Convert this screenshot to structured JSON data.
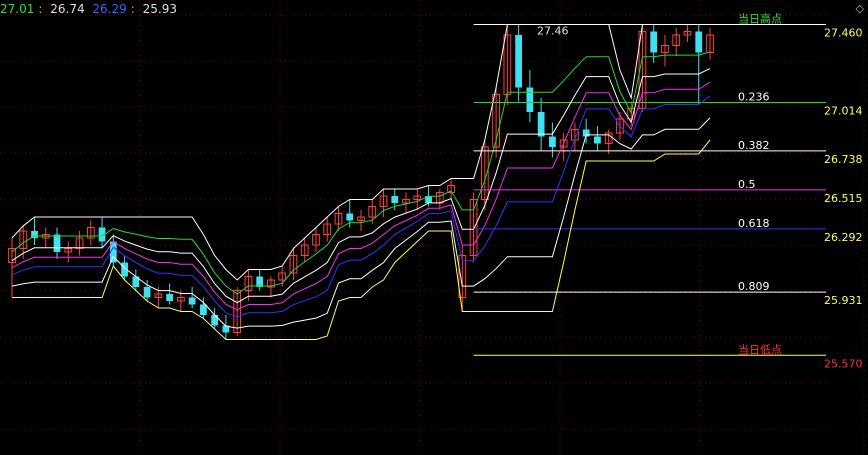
{
  "legend": {
    "v1": "27.01",
    "v1_color": "#33dd33",
    "v2": "26.74",
    "v2_color": "#e0e0e0",
    "v3": "26.29",
    "v3_color": "#3366ff",
    "v4": "25.93",
    "v4_color": "#e0e0e0"
  },
  "corner_glyph": "◇",
  "colors": {
    "up": "#ff4040",
    "down": "#40e0f0",
    "grid": "#7a0000",
    "price_label": "#ffff55",
    "low_label": "#ff3030"
  },
  "chart_data": {
    "type": "candlestick",
    "ylim": [
      25.0,
      27.6
    ],
    "grid": true,
    "high_marker": "27.46",
    "fib_levels": [
      {
        "ratio": "当日高点",
        "value": 27.46,
        "value_text": "27.460",
        "color": "#ffffff",
        "text_color": "#33dd33"
      },
      {
        "ratio": "0.236",
        "value": 27.014,
        "value_text": "27.014",
        "color": "#22dd22",
        "text_color": "#ffffff"
      },
      {
        "ratio": "0.382",
        "value": 26.738,
        "value_text": "26.738",
        "color": "#ffffff",
        "text_color": "#ffffff"
      },
      {
        "ratio": "0.5",
        "value": 26.515,
        "value_text": "26.515",
        "color": "#ee33ee",
        "text_color": "#ffffff"
      },
      {
        "ratio": "0.618",
        "value": 26.292,
        "value_text": "26.292",
        "color": "#3333ff",
        "text_color": "#ffffff"
      },
      {
        "ratio": "0.809",
        "value": 25.931,
        "value_text": "25.931",
        "color": "#ffffff",
        "text_color": "#ffffff"
      },
      {
        "ratio": "当日低点",
        "value": 25.57,
        "value_text": "25.570",
        "color": "#ffff55",
        "text_color": "#ff3030"
      }
    ],
    "candles": [
      [
        26.1,
        26.24,
        25.9,
        26.18
      ],
      [
        26.18,
        26.31,
        26.12,
        26.28
      ],
      [
        26.28,
        26.36,
        26.2,
        26.24
      ],
      [
        26.24,
        26.3,
        26.18,
        26.26
      ],
      [
        26.26,
        26.3,
        26.12,
        26.16
      ],
      [
        26.16,
        26.22,
        26.1,
        26.18
      ],
      [
        26.18,
        26.28,
        26.14,
        26.24
      ],
      [
        26.24,
        26.34,
        26.2,
        26.3
      ],
      [
        26.3,
        26.36,
        26.18,
        26.22
      ],
      [
        26.22,
        26.26,
        26.08,
        26.1
      ],
      [
        26.1,
        26.14,
        26.0,
        26.02
      ],
      [
        26.02,
        26.06,
        25.94,
        25.96
      ],
      [
        25.96,
        26.0,
        25.88,
        25.9
      ],
      [
        25.9,
        25.96,
        25.84,
        25.92
      ],
      [
        25.92,
        25.98,
        25.86,
        25.88
      ],
      [
        25.88,
        25.94,
        25.82,
        25.9
      ],
      [
        25.9,
        25.96,
        25.84,
        25.86
      ],
      [
        25.86,
        25.9,
        25.78,
        25.8
      ],
      [
        25.8,
        25.84,
        25.72,
        25.74
      ],
      [
        25.74,
        25.8,
        25.66,
        25.7
      ],
      [
        25.7,
        25.96,
        25.68,
        25.94
      ],
      [
        25.94,
        26.06,
        25.88,
        26.02
      ],
      [
        26.02,
        26.06,
        25.94,
        25.96
      ],
      [
        25.96,
        26.02,
        25.9,
        26.0
      ],
      [
        26.0,
        26.08,
        25.96,
        26.04
      ],
      [
        26.04,
        26.18,
        26.0,
        26.14
      ],
      [
        26.14,
        26.24,
        26.1,
        26.2
      ],
      [
        26.2,
        26.3,
        26.16,
        26.26
      ],
      [
        26.26,
        26.36,
        26.22,
        26.32
      ],
      [
        26.32,
        26.42,
        26.28,
        26.38
      ],
      [
        26.38,
        26.46,
        26.3,
        26.34
      ],
      [
        26.34,
        26.4,
        26.28,
        26.36
      ],
      [
        26.36,
        26.46,
        26.32,
        26.42
      ],
      [
        26.42,
        26.52,
        26.36,
        26.48
      ],
      [
        26.48,
        26.52,
        26.4,
        26.44
      ],
      [
        26.44,
        26.5,
        26.38,
        26.46
      ],
      [
        26.46,
        26.52,
        26.4,
        26.48
      ],
      [
        26.48,
        26.54,
        26.42,
        26.44
      ],
      [
        26.44,
        26.52,
        26.4,
        26.5
      ],
      [
        26.5,
        26.58,
        26.46,
        26.54
      ],
      [
        25.9,
        26.2,
        25.82,
        26.14
      ],
      [
        26.14,
        26.5,
        26.1,
        26.46
      ],
      [
        26.46,
        26.8,
        26.4,
        26.76
      ],
      [
        26.76,
        27.1,
        26.7,
        27.06
      ],
      [
        27.06,
        27.46,
        27.0,
        27.4
      ],
      [
        27.4,
        27.46,
        27.02,
        27.1
      ],
      [
        27.1,
        27.2,
        26.9,
        26.96
      ],
      [
        26.96,
        27.04,
        26.74,
        26.82
      ],
      [
        26.82,
        26.9,
        26.7,
        26.76
      ],
      [
        26.76,
        26.84,
        26.68,
        26.8
      ],
      [
        26.8,
        26.9,
        26.74,
        26.86
      ],
      [
        26.86,
        26.92,
        26.78,
        26.82
      ],
      [
        26.82,
        26.88,
        26.74,
        26.78
      ],
      [
        26.78,
        26.86,
        26.72,
        26.84
      ],
      [
        26.84,
        26.96,
        26.8,
        26.92
      ],
      [
        26.92,
        27.02,
        26.88,
        26.98
      ],
      [
        26.98,
        27.46,
        26.96,
        27.42
      ],
      [
        27.42,
        27.46,
        27.24,
        27.3
      ],
      [
        27.3,
        27.4,
        27.22,
        27.34
      ],
      [
        27.34,
        27.44,
        27.28,
        27.4
      ],
      [
        27.4,
        27.46,
        27.36,
        27.42
      ],
      [
        27.42,
        27.46,
        27.0,
        27.3
      ],
      [
        27.3,
        27.44,
        27.26,
        27.4
      ]
    ]
  }
}
